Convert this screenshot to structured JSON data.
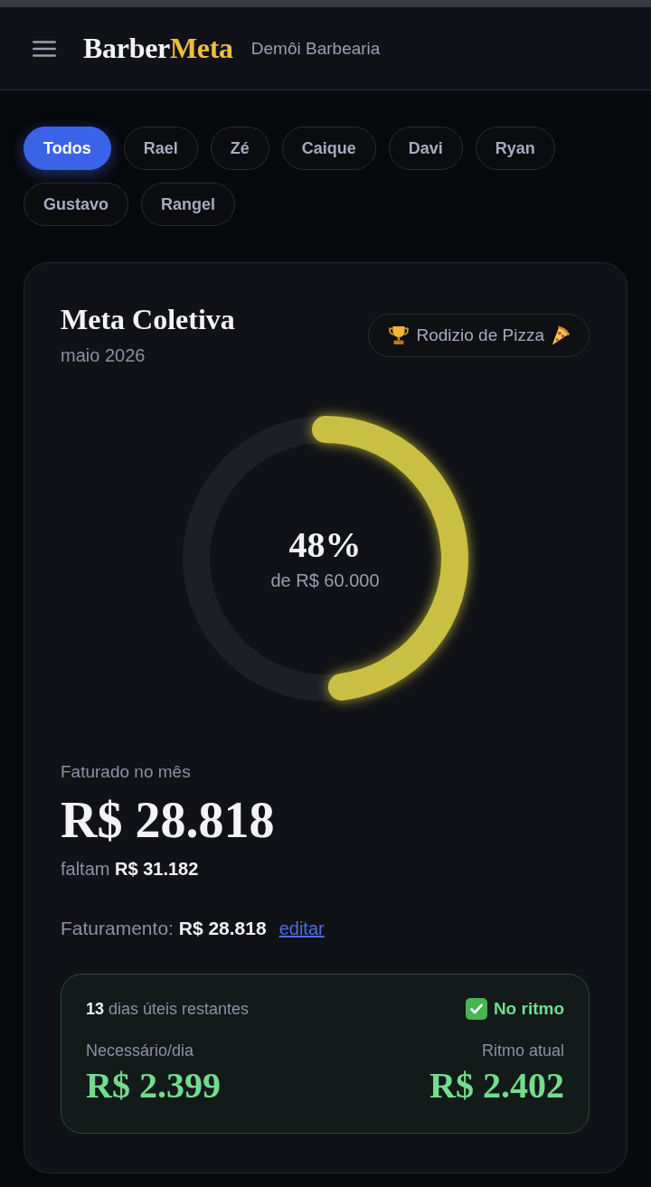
{
  "header": {
    "logo": {
      "first": "Barber",
      "second": "Meta"
    },
    "shop_name": "Demôi Barbearia"
  },
  "filters": [
    {
      "label": "Todos",
      "selected": true
    },
    {
      "label": "Rael",
      "selected": false
    },
    {
      "label": "Zé",
      "selected": false
    },
    {
      "label": "Caique",
      "selected": false
    },
    {
      "label": "Davi",
      "selected": false
    },
    {
      "label": "Ryan",
      "selected": false
    },
    {
      "label": "Gustavo",
      "selected": false
    },
    {
      "label": "Rangel",
      "selected": false
    }
  ],
  "goal": {
    "title": "Meta Coletiva",
    "period": "maio 2026",
    "prize": "Rodizio de Pizza",
    "progress": {
      "level": 0.48,
      "percent": "48%",
      "target": "de R$ 60.000"
    },
    "billed_label": "Faturado no mês",
    "billed_value": "R$ 28.818",
    "remaining": "faltam **R$ 31.182**",
    "revenue": {
      "text": "Faturamento: **R$ 28.818**",
      "link": "editar"
    },
    "pace": {
      "days_left": "**13** dias úteis restantes",
      "status": {
        "on_track": true,
        "label": "No ritmo"
      },
      "needed_label": "Necessário/dia",
      "needed_value": "R$ 2.399",
      "current_label": "Ritmo atual",
      "current_value": "R$ 2.402"
    }
  }
}
